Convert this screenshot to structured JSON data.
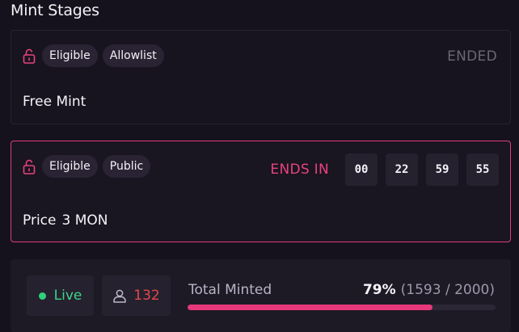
{
  "page": {
    "title": "Mint Stages"
  },
  "stages": [
    {
      "badges": [
        "Eligible",
        "Allowlist"
      ],
      "status": "ENDED",
      "name": "Free Mint"
    },
    {
      "badges": [
        "Eligible",
        "Public"
      ],
      "ends_label": "ENDS IN",
      "countdown": [
        "00",
        "22",
        "59",
        "55"
      ],
      "price_label": "Price",
      "price_value": "3 MON"
    }
  ],
  "stats": {
    "live_label": "Live",
    "holders_count": "132",
    "total_minted_label": "Total Minted",
    "percent": "79%",
    "fraction": "(1593 / 2000)",
    "progress": 0.7965
  },
  "colors": {
    "accent": "#e8387c",
    "live": "#30d07d",
    "holders": "#e5474d"
  },
  "icons": {
    "lock": "lock-open-icon",
    "user": "user-icon",
    "live": "status-dot-icon"
  }
}
